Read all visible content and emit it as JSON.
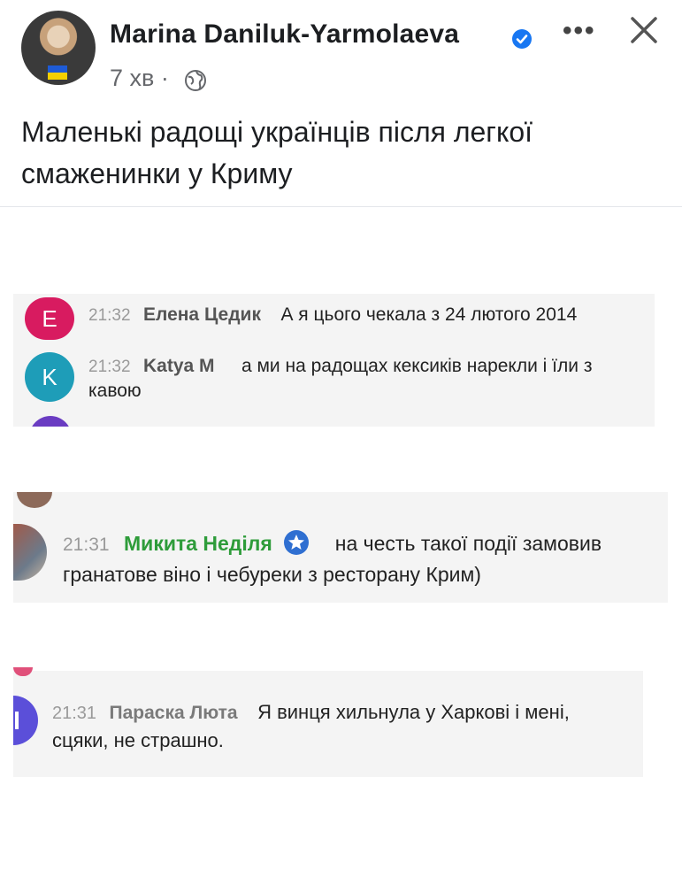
{
  "post": {
    "author": "Marina Daniluk-Yarmolaeva",
    "time": "7 хв",
    "dot": "·",
    "text_line1": "Маленькі радощі українців після легкої",
    "text_line2": "смаженинки у Криму"
  },
  "screenshot1": {
    "messages": [
      {
        "initial": "Е",
        "time": "21:32",
        "name": "Елена Цедик",
        "text": "А я цього чекала з 24 лютого 2014",
        "avatar_color": "#d81b60"
      },
      {
        "initial": "K",
        "time": "21:32",
        "name": "Katya M",
        "text": "а ми на радощах кексиків нарекли і їли з",
        "text2": "кавою",
        "avatar_color": "#1e9db8"
      }
    ]
  },
  "screenshot2": {
    "message": {
      "time": "21:31",
      "name": "Микита Неділя",
      "text": "на честь такої події замовив",
      "text2": "гранатове віно і чебуреки з ресторану Крим)",
      "name_color": "#2e9c3a"
    }
  },
  "screenshot3": {
    "message": {
      "time": "21:31",
      "name": "Параска Люта",
      "text": "Я винця хильнула у Харкові і мені,",
      "text2": "сцяки, не страшно."
    }
  },
  "icons": {
    "verified": "verified-badge-icon",
    "more": "more-options-icon",
    "close": "close-icon",
    "globe": "globe-icon",
    "star": "star-badge-icon"
  },
  "colors": {
    "verified": "#1877f2",
    "meta": "#65676b"
  }
}
